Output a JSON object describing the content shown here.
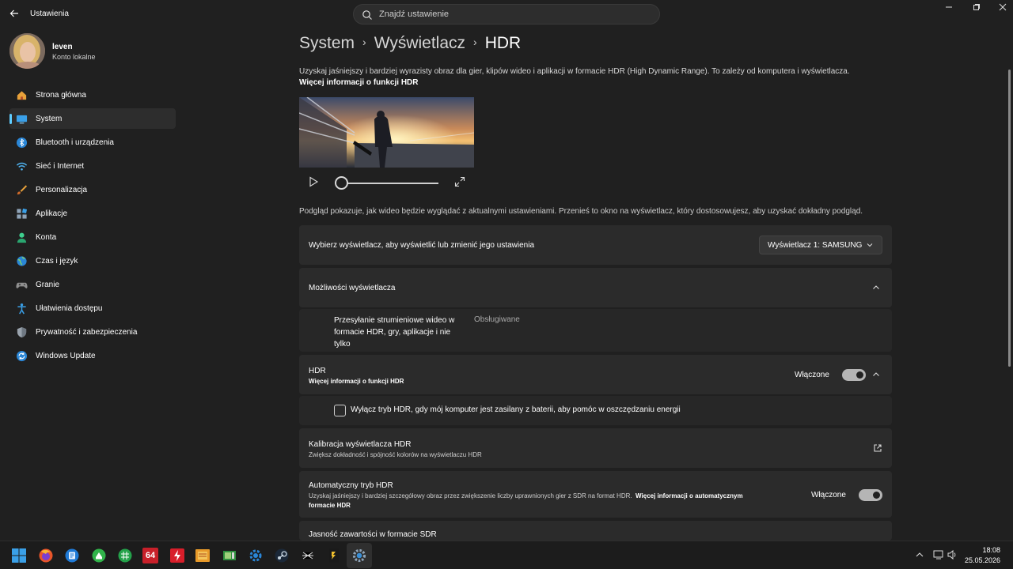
{
  "titlebar": {
    "app_title": "Ustawienia",
    "search_placeholder": "Znajdź ustawienie"
  },
  "user": {
    "name": "leven",
    "account": "Konto lokalne"
  },
  "sidebar": {
    "items": [
      {
        "label": "Strona główna",
        "icon": "home-icon"
      },
      {
        "label": "System",
        "icon": "monitor-icon",
        "active": true
      },
      {
        "label": "Bluetooth i urządzenia",
        "icon": "bluetooth-icon"
      },
      {
        "label": "Sieć i Internet",
        "icon": "wifi-icon"
      },
      {
        "label": "Personalizacja",
        "icon": "brush-icon"
      },
      {
        "label": "Aplikacje",
        "icon": "apps-icon"
      },
      {
        "label": "Konta",
        "icon": "person-icon"
      },
      {
        "label": "Czas i język",
        "icon": "globe-icon"
      },
      {
        "label": "Granie",
        "icon": "gamepad-icon"
      },
      {
        "label": "Ułatwienia dostępu",
        "icon": "accessibility-icon"
      },
      {
        "label": "Prywatność i zabezpieczenia",
        "icon": "shield-icon"
      },
      {
        "label": "Windows Update",
        "icon": "update-icon"
      }
    ]
  },
  "breadcrumb": {
    "level1": "System",
    "level2": "Wyświetlacz",
    "level3": "HDR"
  },
  "intro": {
    "description": "Uzyskaj jaśniejszy i bardziej wyrazisty obraz dla gier, klipów wideo i aplikacji w formacie HDR (High Dynamic Range). To zależy od komputera i wyświetlacza.",
    "link": "Więcej informacji o funkcji HDR",
    "preview_note": "Podgląd pokazuje, jak wideo będzie wyglądać z aktualnymi ustawieniami. Przenieś to okno na wyświetlacz, który dostosowujesz, aby uzyskać dokładny podgląd."
  },
  "player": {
    "progress": 0
  },
  "display_select": {
    "label": "Wybierz wyświetlacz, aby wyświetlić lub zmienić jego ustawienia",
    "value": "Wyświetlacz 1: SAMSUNG"
  },
  "capabilities": {
    "title": "Możliwości wyświetlacza",
    "row_label_lines": [
      "Przesyłanie strumieniowe wideo w",
      "formacie HDR, gry, aplikacje i nie",
      "tylko"
    ],
    "row_value": "Obsługiwane"
  },
  "hdr": {
    "title": "HDR",
    "link": "Więcej informacji o funkcji HDR",
    "state_label": "Włączone",
    "enabled": true,
    "battery_option": "Wyłącz tryb HDR, gdy mój komputer jest zasilany z baterii, aby pomóc w oszczędzaniu energii",
    "battery_checked": false
  },
  "calibration": {
    "title": "Kalibracja wyświetlacza HDR",
    "subtitle": "Zwiększ dokładność i spójność kolorów na wyświetlaczu HDR"
  },
  "auto_hdr": {
    "title": "Automatyczny tryb HDR",
    "subtitle": "Uzyskaj jaśniejszy i bardziej szczegółowy obraz przez zwiększenie liczby uprawnionych gier z SDR na format HDR.",
    "link_part1": "Więcej informacji o automatycznym",
    "link_part2": "formacie HDR",
    "state_label": "Włączone",
    "enabled": true
  },
  "sdr": {
    "title": "Jasność zawartości w formacie SDR"
  },
  "taskbar": {
    "time": "18:08",
    "date": "25.05.2026",
    "badge_64": "64"
  },
  "colors": {
    "accent": "#60cdff",
    "background": "#202020",
    "card": "#2b2b2b"
  }
}
